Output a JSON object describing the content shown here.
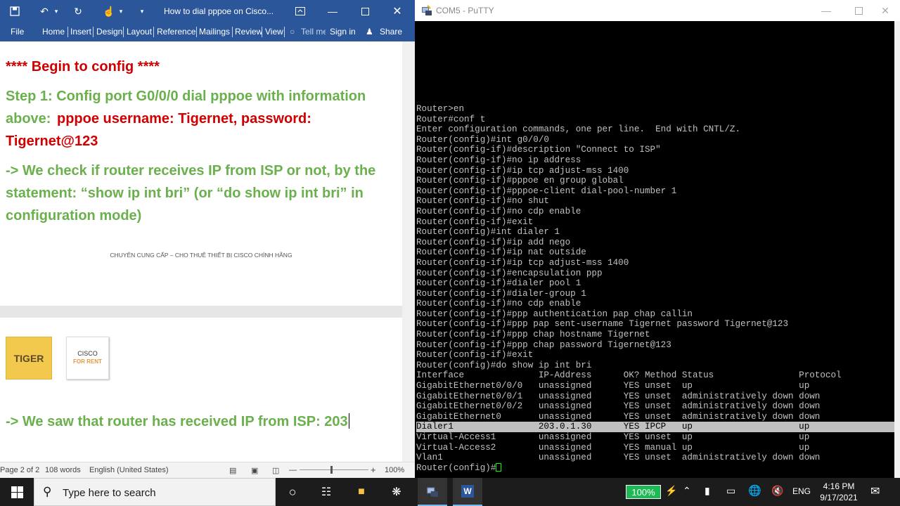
{
  "word": {
    "title": "How to dial pppoe on Cisco...",
    "ribbon": {
      "file": "File",
      "tabs": [
        "Home",
        "Insert",
        "Design",
        "Layout",
        "References",
        "Mailings",
        "Review",
        "View"
      ],
      "tell_me": "Tell me",
      "sign_in": "Sign in",
      "share": "Share"
    },
    "doc": {
      "heading": "**** Begin to config ****",
      "step1_a": "Step 1: Config port G0/0/0 dial pppoe with information",
      "step1_b": "above:",
      "step1_c": "pppoe username: Tigernet, password:",
      "step1_d": "Tigernet@123",
      "check_a": "-> We check if router receives IP from ISP or not, by the",
      "check_b": "statement: “show ip int bri” (or “do show ip int bri” in",
      "check_c": "configuration mode)",
      "footer": "CHUYÊN CUNG CẤP – CHO THUÊ THIẾT BỊ CISCO CHÍNH HÃNG",
      "logo_tiger": "TIGER",
      "logo_cisco_top": "CISCO",
      "logo_cisco_bottom": "FOR RENT",
      "result": "-> We saw that router has received IP from ISP: 203"
    },
    "status": {
      "page": "Page 2 of 2",
      "words": "108 words",
      "language": "English (United States)",
      "zoom": "100%"
    }
  },
  "putty": {
    "title": "COM5 - PuTTY",
    "lines": [
      "Router>en",
      "Router#conf t",
      "Enter configuration commands, one per line.  End with CNTL/Z.",
      "Router(config)#int g0/0/0",
      "Router(config-if)#description \"Connect to ISP\"",
      "Router(config-if)#no ip address",
      "Router(config-if)#ip tcp adjust-mss 1400",
      "Router(config-if)#pppoe en group global",
      "Router(config-if)#pppoe-client dial-pool-number 1",
      "Router(config-if)#no shut",
      "Router(config-if)#no cdp enable",
      "Router(config-if)#exit",
      "Router(config)#int dialer 1",
      "Router(config-if)#ip add nego",
      "Router(config-if)#ip nat outside",
      "Router(config-if)#ip tcp adjust-mss 1400",
      "Router(config-if)#encapsulation ppp",
      "Router(config-if)#dialer pool 1",
      "Router(config-if)#dialer-group 1",
      "Router(config-if)#no cdp enable",
      "Router(config-if)#ppp authentication pap chap callin",
      "Router(config-if)#ppp pap sent-username Tigernet password Tigernet@123",
      "Router(config-if)#ppp chap hostname Tigernet",
      "Router(config-if)#ppp chap password Tigernet@123",
      "Router(config-if)#exit",
      "Router(config)#do show ip int bri",
      "Interface              IP-Address      OK? Method Status                Protocol",
      "GigabitEthernet0/0/0   unassigned      YES unset  up                    up",
      "GigabitEthernet0/0/1   unassigned      YES unset  administratively down down",
      "GigabitEthernet0/0/2   unassigned      YES unset  administratively down down",
      "GigabitEthernet0       unassigned      YES unset  administratively down down",
      "Dialer1                203.0.1.30      YES IPCP   up                    up",
      "Virtual-Access1        unassigned      YES unset  up                    up",
      "Virtual-Access2        unassigned      YES manual up                    up",
      "Vlan1                  unassigned      YES unset  administratively down down"
    ],
    "prompt": "Router(config)#"
  },
  "taskbar": {
    "search_placeholder": "Type here to search",
    "battery": "100%",
    "lang": "ENG",
    "time": "4:16 PM",
    "date": "9/17/2021"
  },
  "colors": {
    "word_blue": "#2b579a",
    "doc_green": "#6ab04c",
    "doc_red": "#d00000",
    "terminal_text": "#c0c0c0",
    "battery_green": "#1db954"
  }
}
